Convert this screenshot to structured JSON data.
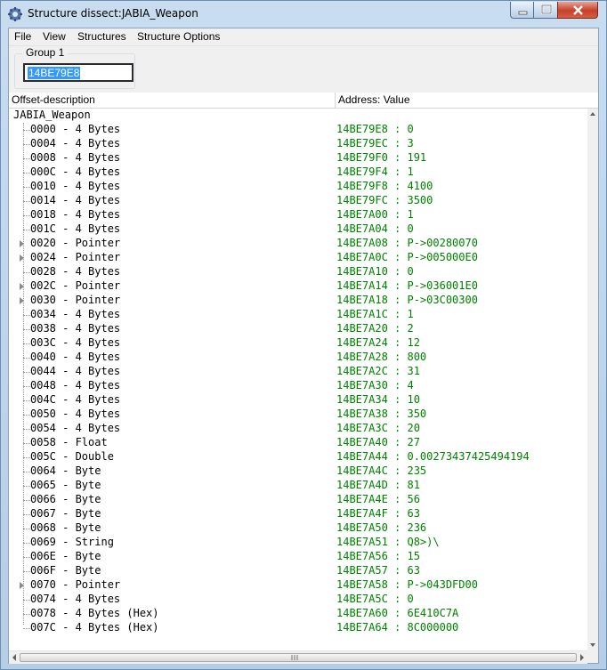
{
  "window": {
    "title": "Structure dissect:JABIA_Weapon",
    "icon": "cheat-engine-gear-icon"
  },
  "menu": [
    "File",
    "View",
    "Structures",
    "Structure Options"
  ],
  "group": {
    "label": "Group 1",
    "address": "14BE79E8"
  },
  "columns": [
    "Offset-description",
    "Address: Value"
  ],
  "root": "JABIA_Weapon",
  "rows": [
    {
      "desc": "0000 - 4 Bytes",
      "addr": "14BE79E8 : 0",
      "expandable": false
    },
    {
      "desc": "0004 - 4 Bytes",
      "addr": "14BE79EC : 3",
      "expandable": false
    },
    {
      "desc": "0008 - 4 Bytes",
      "addr": "14BE79F0 : 191",
      "expandable": false
    },
    {
      "desc": "000C - 4 Bytes",
      "addr": "14BE79F4 : 1",
      "expandable": false
    },
    {
      "desc": "0010 - 4 Bytes",
      "addr": "14BE79F8 : 4100",
      "expandable": false
    },
    {
      "desc": "0014 - 4 Bytes",
      "addr": "14BE79FC : 3500",
      "expandable": false
    },
    {
      "desc": "0018 - 4 Bytes",
      "addr": "14BE7A00 : 1",
      "expandable": false
    },
    {
      "desc": "001C - 4 Bytes",
      "addr": "14BE7A04 : 0",
      "expandable": false
    },
    {
      "desc": "0020 - Pointer",
      "addr": "14BE7A08 : P->00280070",
      "expandable": true
    },
    {
      "desc": "0024 - Pointer",
      "addr": "14BE7A0C : P->005000E0",
      "expandable": true
    },
    {
      "desc": "0028 - 4 Bytes",
      "addr": "14BE7A10 : 0",
      "expandable": false
    },
    {
      "desc": "002C - Pointer",
      "addr": "14BE7A14 : P->036001E0",
      "expandable": true
    },
    {
      "desc": "0030 - Pointer",
      "addr": "14BE7A18 : P->03C00300",
      "expandable": true
    },
    {
      "desc": "0034 - 4 Bytes",
      "addr": "14BE7A1C : 1",
      "expandable": false
    },
    {
      "desc": "0038 - 4 Bytes",
      "addr": "14BE7A20 : 2",
      "expandable": false
    },
    {
      "desc": "003C - 4 Bytes",
      "addr": "14BE7A24 : 12",
      "expandable": false
    },
    {
      "desc": "0040 - 4 Bytes",
      "addr": "14BE7A28 : 800",
      "expandable": false
    },
    {
      "desc": "0044 - 4 Bytes",
      "addr": "14BE7A2C : 31",
      "expandable": false
    },
    {
      "desc": "0048 - 4 Bytes",
      "addr": "14BE7A30 : 4",
      "expandable": false
    },
    {
      "desc": "004C - 4 Bytes",
      "addr": "14BE7A34 : 10",
      "expandable": false
    },
    {
      "desc": "0050 - 4 Bytes",
      "addr": "14BE7A38 : 350",
      "expandable": false
    },
    {
      "desc": "0054 - 4 Bytes",
      "addr": "14BE7A3C : 20",
      "expandable": false
    },
    {
      "desc": "0058 - Float",
      "addr": "14BE7A40 : 27",
      "expandable": false
    },
    {
      "desc": "005C - Double",
      "addr": "14BE7A44 : 0.00273437425494194",
      "expandable": false
    },
    {
      "desc": "0064 - Byte",
      "addr": "14BE7A4C : 235",
      "expandable": false
    },
    {
      "desc": "0065 - Byte",
      "addr": "14BE7A4D : 81",
      "expandable": false
    },
    {
      "desc": "0066 - Byte",
      "addr": "14BE7A4E : 56",
      "expandable": false
    },
    {
      "desc": "0067 - Byte",
      "addr": "14BE7A4F : 63",
      "expandable": false
    },
    {
      "desc": "0068 - Byte",
      "addr": "14BE7A50 : 236",
      "expandable": false
    },
    {
      "desc": "0069 - String",
      "addr": "14BE7A51 : Q8>)\\",
      "expandable": false
    },
    {
      "desc": "006E - Byte",
      "addr": "14BE7A56 : 15",
      "expandable": false
    },
    {
      "desc": "006F - Byte",
      "addr": "14BE7A57 : 63",
      "expandable": false
    },
    {
      "desc": "0070 - Pointer",
      "addr": "14BE7A58 : P->043DFD00",
      "expandable": true
    },
    {
      "desc": "0074 - 4 Bytes",
      "addr": "14BE7A5C : 0",
      "expandable": false
    },
    {
      "desc": "0078 - 4 Bytes (Hex)",
      "addr": "14BE7A60 : 6E410C7A",
      "expandable": false
    },
    {
      "desc": "007C - 4 Bytes (Hex)",
      "addr": "14BE7A64 : 8C000000",
      "expandable": false
    }
  ],
  "colors": {
    "value_text": "#008000",
    "selection": "#3399ff"
  }
}
